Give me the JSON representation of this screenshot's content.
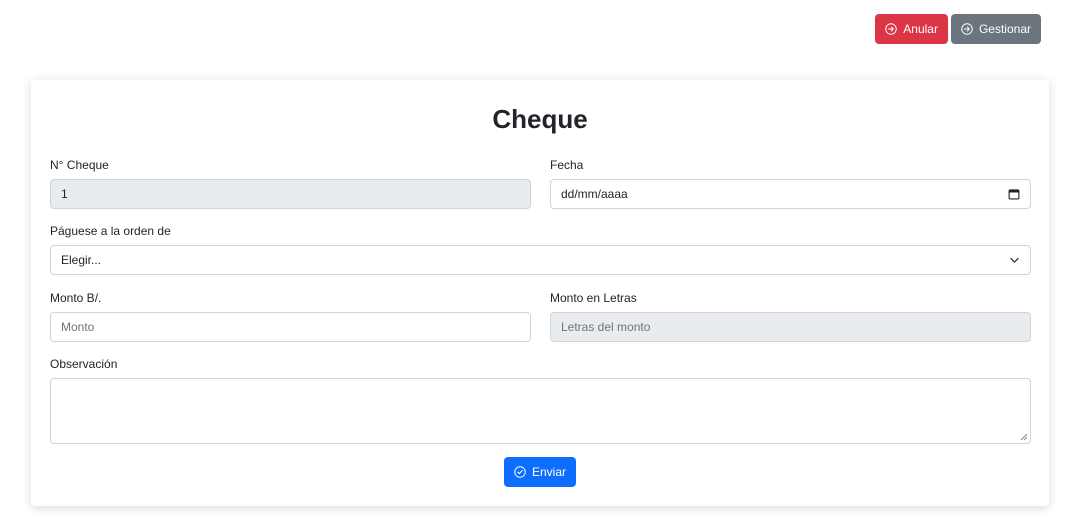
{
  "actions": {
    "cancel_label": "Anular",
    "manage_label": "Gestionar"
  },
  "form": {
    "title": "Cheque",
    "cheque_number": {
      "label": "N° Cheque",
      "value": "1"
    },
    "date": {
      "label": "Fecha",
      "value": "dd/mm/aaaa"
    },
    "payee": {
      "label": "Páguese a la orden de",
      "selected": "Elegir..."
    },
    "amount": {
      "label": "Monto B/.",
      "placeholder": "Monto"
    },
    "amount_words": {
      "label": "Monto en Letras",
      "placeholder": "Letras del monto"
    },
    "notes": {
      "label": "Observación",
      "value": ""
    },
    "submit_label": "Enviar"
  },
  "colors": {
    "danger": "#dc3545",
    "secondary": "#6c757d",
    "primary": "#0d6efd",
    "disabled_field": "#e9ecef"
  },
  "icons": {
    "cancel": "arrow-right-circle-icon",
    "manage": "arrow-right-circle-icon",
    "date": "calendar-icon",
    "payee": "chevron-down-icon",
    "submit": "check-circle-icon"
  }
}
